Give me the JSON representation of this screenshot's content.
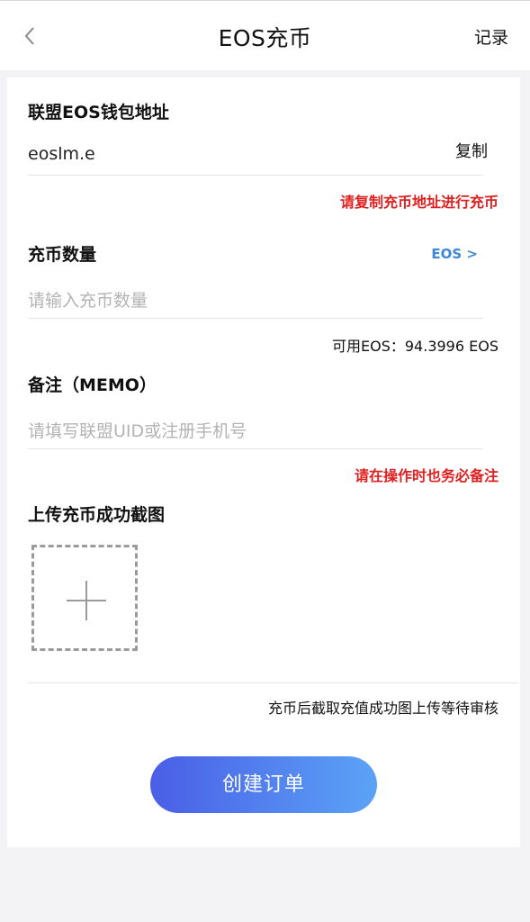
{
  "header": {
    "title": "EOS充币",
    "record_label": "记录"
  },
  "address_section": {
    "label": "联盟EOS钱包地址",
    "value": "eoslm.e",
    "copy_label": "复制",
    "hint": "请复制充币地址进行充币"
  },
  "amount_section": {
    "label": "充币数量",
    "currency_link": "EOS >",
    "placeholder": "请输入充币数量",
    "available": "可用EOS：94.3996 EOS"
  },
  "memo_section": {
    "label": "备注（MEMO）",
    "placeholder": "请填写联盟UID或注册手机号",
    "hint": "请在操作时也务必备注"
  },
  "upload_section": {
    "label": "上传充币成功截图",
    "hint": "充币后截取充值成功图上传等待审核"
  },
  "submit_label": "创建订单",
  "colors": {
    "accent_red": "#e02020",
    "link_blue": "#3e86d6",
    "button_gradient_start": "#4a5ee6",
    "button_gradient_end": "#5ba3f7"
  },
  "icons": {
    "back": "chevron-left-icon",
    "upload": "plus-icon"
  }
}
